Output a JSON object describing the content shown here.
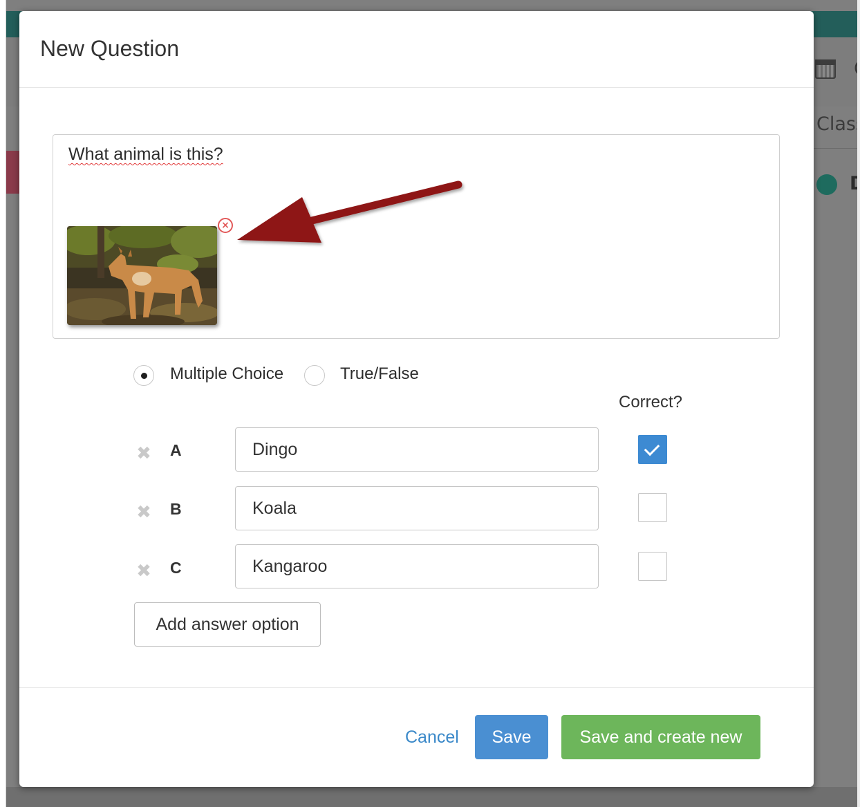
{
  "background": {
    "toolbar_c_letter": "C",
    "class_label": "Class",
    "list_item_letter": "D"
  },
  "modal": {
    "title": "New Question",
    "question": {
      "text": "What animal is this?",
      "image_icon": "remove-image-icon"
    },
    "question_types": [
      {
        "label": "Multiple Choice",
        "selected": true
      },
      {
        "label": "True/False",
        "selected": false
      }
    ],
    "correct_header": "Correct?",
    "answers": [
      {
        "letter": "A",
        "value": "Dingo",
        "correct": true
      },
      {
        "letter": "B",
        "value": "Koala",
        "correct": false
      },
      {
        "letter": "C",
        "value": "Kangaroo",
        "correct": false
      }
    ],
    "add_option_label": "Add answer option",
    "footer": {
      "cancel_label": "Cancel",
      "save_label": "Save",
      "save_new_label": "Save and create new"
    }
  },
  "colors": {
    "primary": "#4a8fd2",
    "success": "#6db65b",
    "link": "#3b89c9",
    "header_bar": "#235e5a",
    "annotation_arrow": "#8e1616"
  }
}
